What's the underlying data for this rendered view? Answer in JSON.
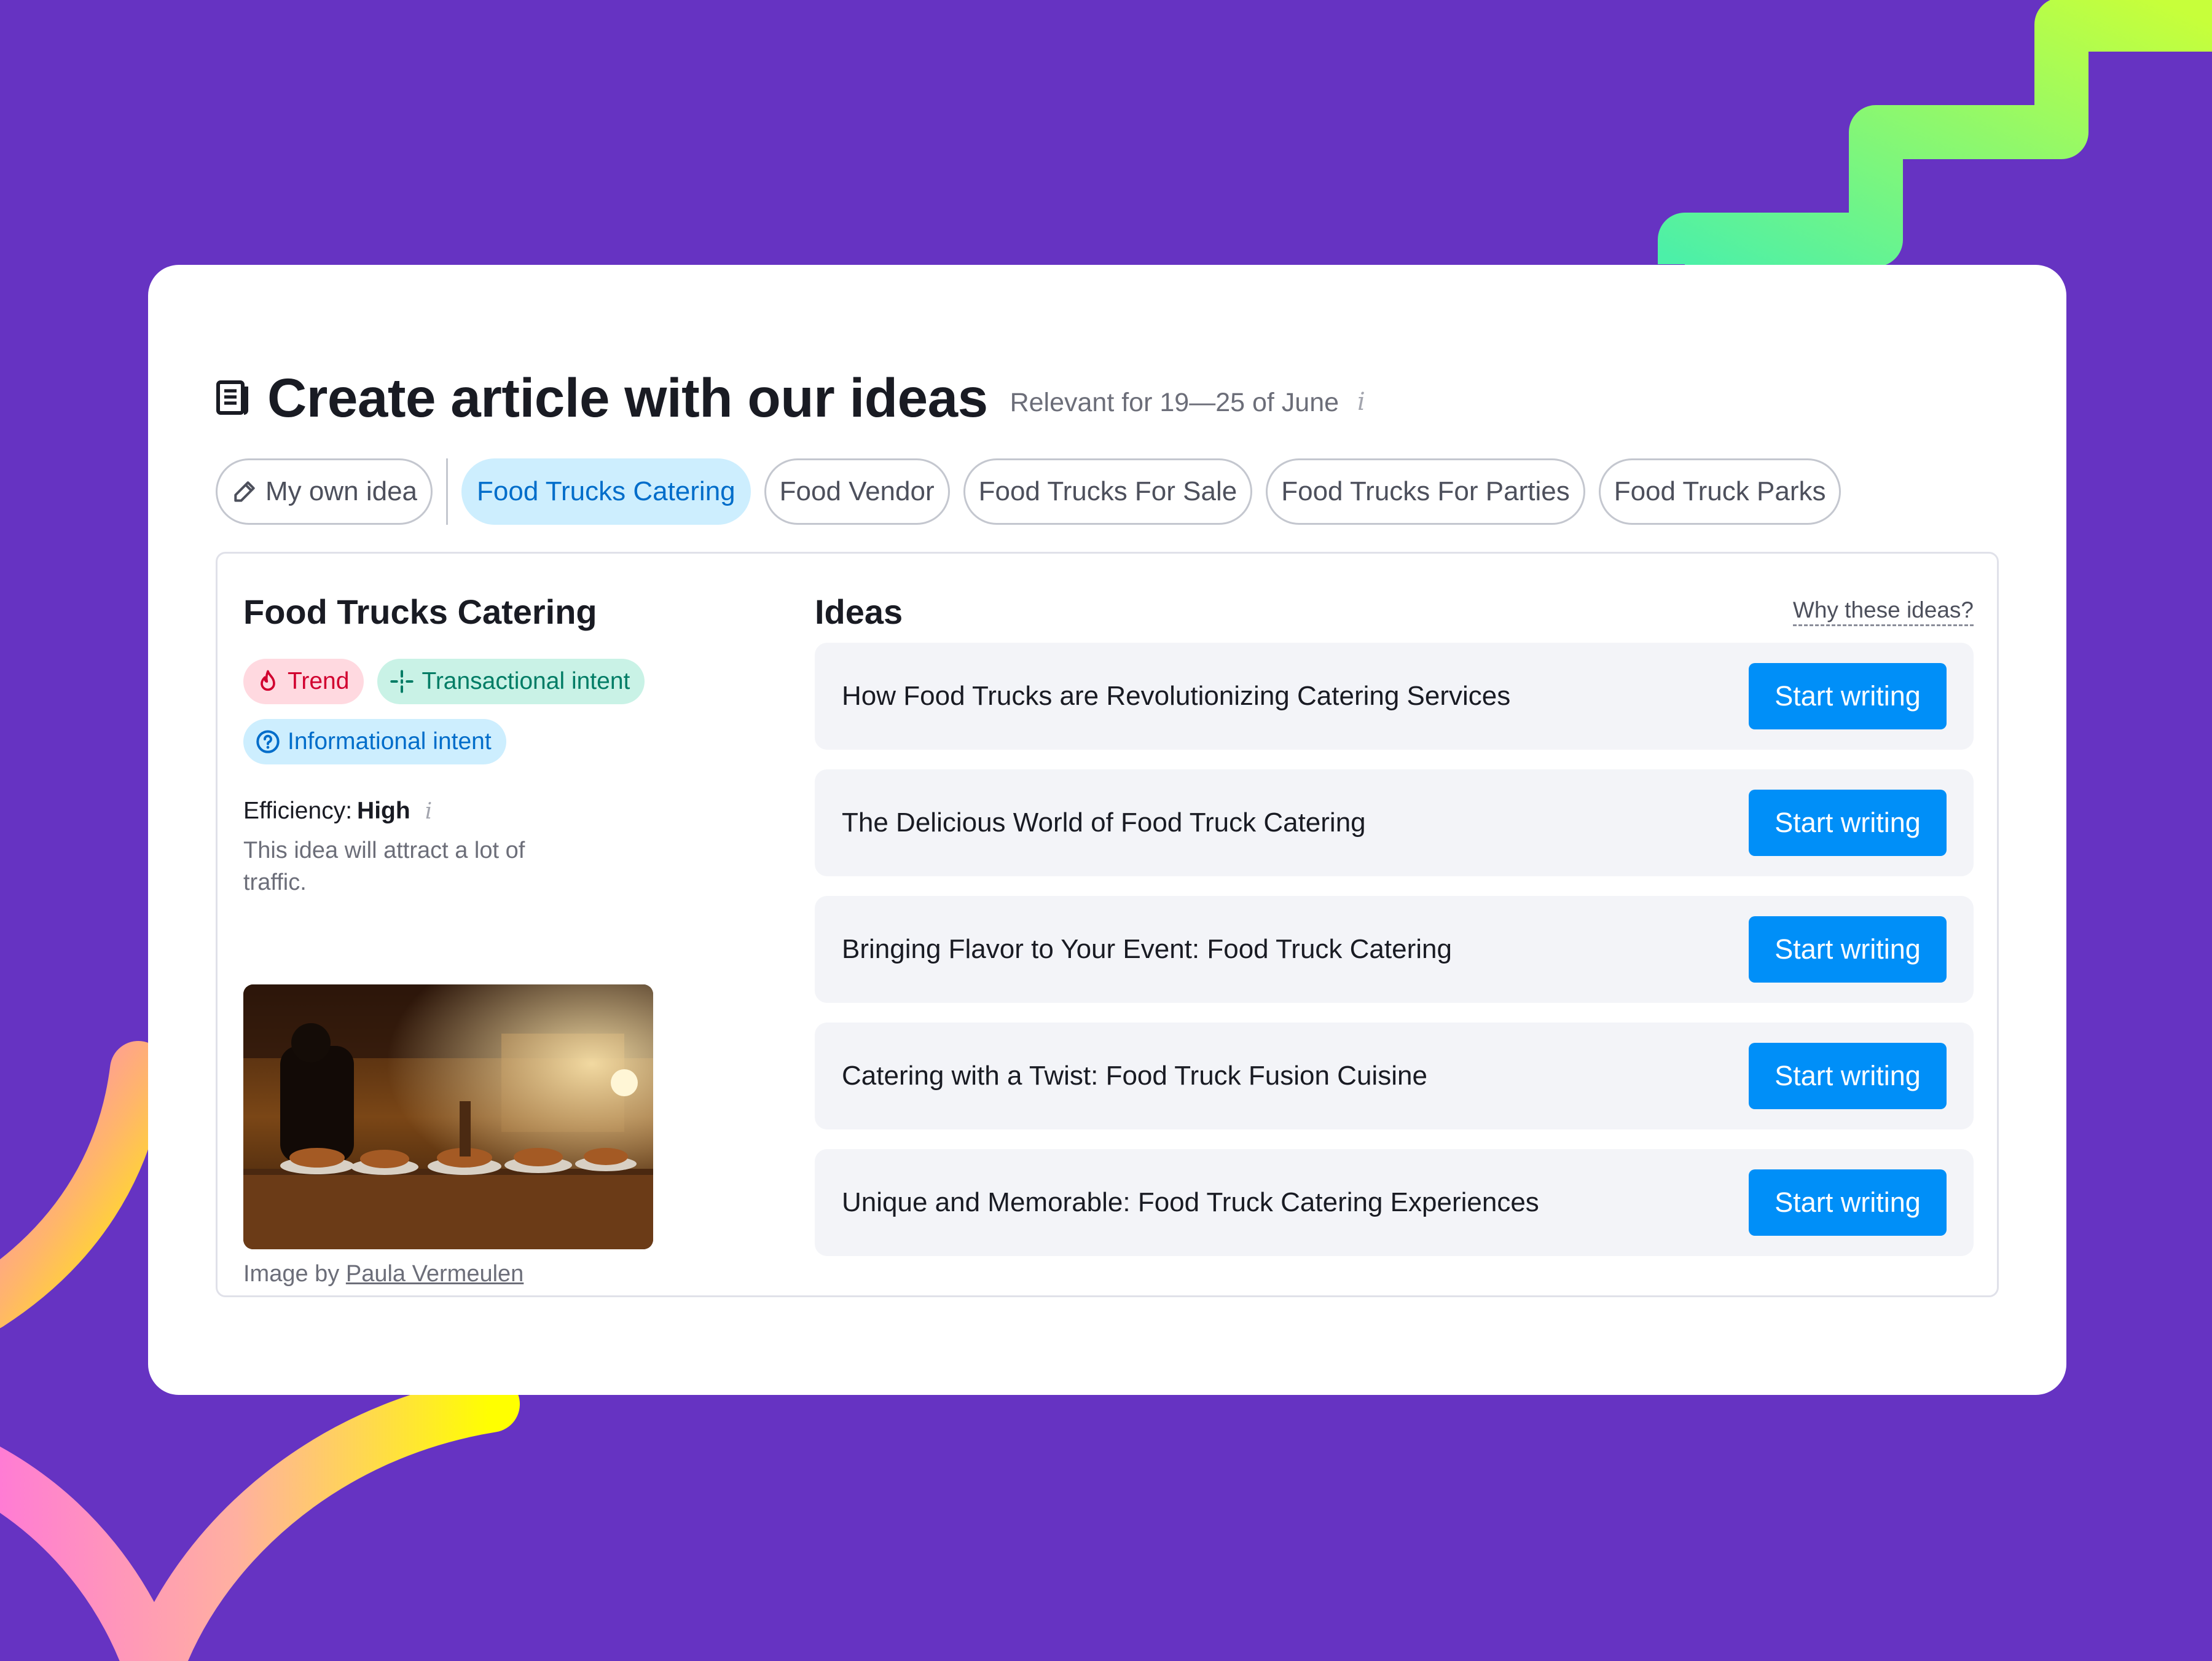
{
  "colors": {
    "background": "#6633c2",
    "accent": "#008ff8",
    "active_tab_bg": "#cdeefe",
    "trend": "#d1002f",
    "transactional": "#007c65",
    "informational": "#006dca"
  },
  "header": {
    "icon": "document-icon",
    "title": "Create article with our ideas",
    "subtitle": "Relevant for 19—25 of June",
    "info_glyph": "i"
  },
  "tabs": {
    "own_idea_icon": "pencil-icon",
    "own_idea": "My own idea",
    "items": [
      {
        "label": "Food Trucks Catering",
        "active": true
      },
      {
        "label": "Food Vendor",
        "active": false
      },
      {
        "label": "Food Trucks For Sale",
        "active": false
      },
      {
        "label": "Food Trucks For Parties",
        "active": false
      },
      {
        "label": "Food Truck Parks",
        "active": false
      }
    ]
  },
  "keyword": {
    "title": "Food Trucks Catering",
    "badges": {
      "trend": {
        "label": "Trend",
        "icon": "flame-icon"
      },
      "transactional": {
        "label": "Transactional intent",
        "icon": "crosshair-icon"
      },
      "informational": {
        "label": "Informational intent",
        "icon": "question-circle-icon"
      }
    },
    "efficiency_label": "Efficiency:",
    "efficiency_value": "High",
    "efficiency_info": "i",
    "efficiency_desc": "This idea will attract a lot of traffic.",
    "image_credit_prefix": "Image by",
    "image_credit_author": "Paula Vermeulen"
  },
  "ideas": {
    "title": "Ideas",
    "why_link": "Why these ideas?",
    "button_label": "Start writing",
    "items": [
      "How Food Trucks are Revolutionizing Catering Services",
      "The Delicious World of Food Truck Catering",
      "Bringing Flavor to Your Event: Food Truck Catering",
      "Catering with a Twist: Food Truck Fusion Cuisine",
      "Unique and Memorable: Food Truck Catering Experiences"
    ]
  }
}
